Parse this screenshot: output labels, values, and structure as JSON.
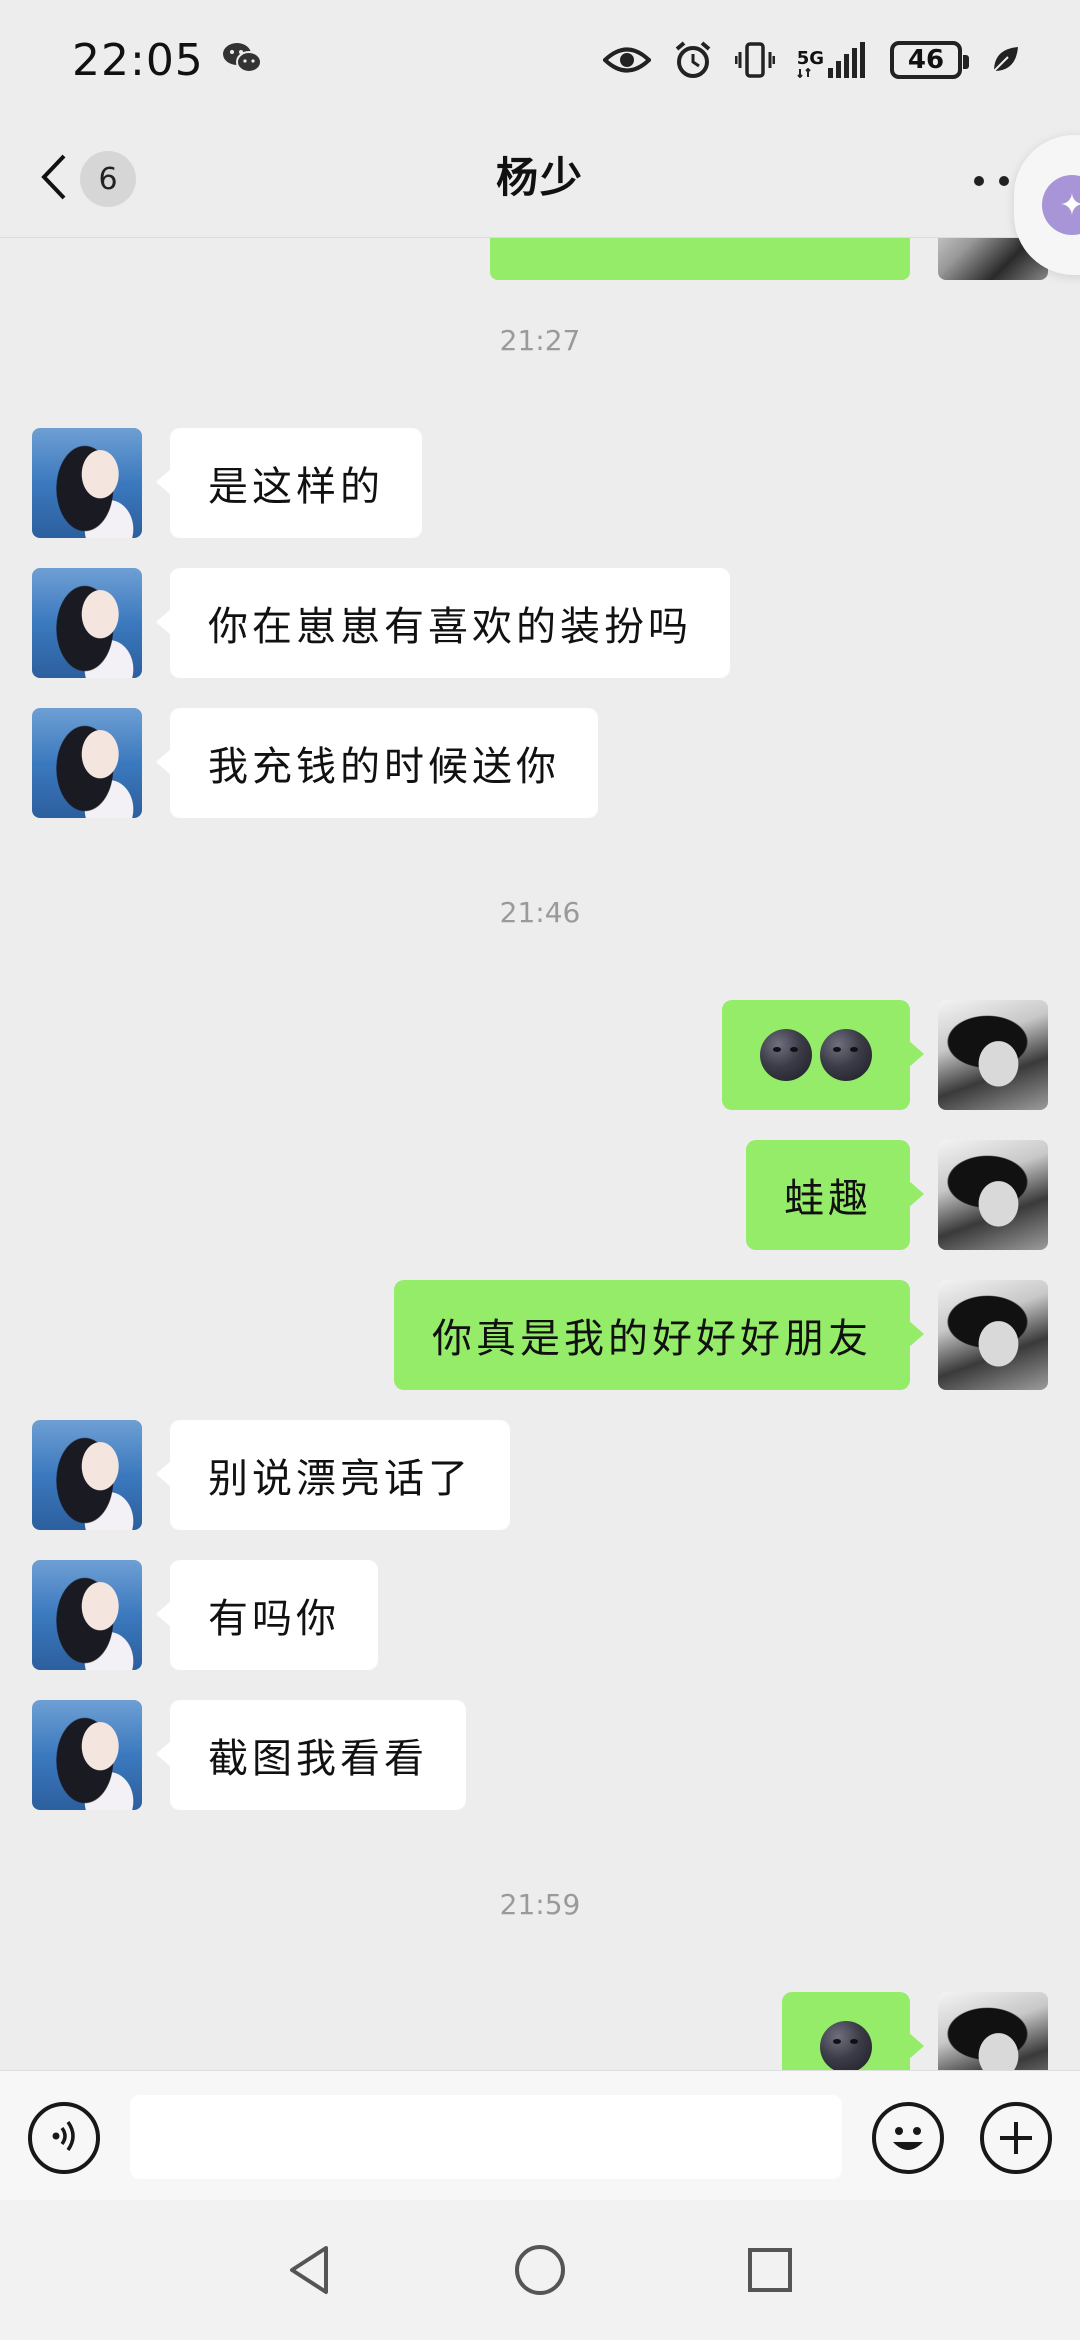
{
  "status_bar": {
    "time": "22:05",
    "network_label": "5G",
    "battery_level": "46",
    "icons": [
      "wechat-icon",
      "eye-icon",
      "alarm-icon",
      "vibrate-icon",
      "signal-icon",
      "battery-icon",
      "leaf-icon"
    ]
  },
  "header": {
    "unread_count": "6",
    "title": "杨少",
    "back_icon": "chevron-left-icon",
    "more_icon": "more-dots-icon"
  },
  "messages": [
    {
      "type": "time",
      "text": "21:27"
    },
    {
      "type": "text",
      "side": "left",
      "text": "是这样的"
    },
    {
      "type": "text",
      "side": "left",
      "text": "你在崽崽有喜欢的装扮吗"
    },
    {
      "type": "text",
      "side": "left",
      "text": "我充钱的时候送你"
    },
    {
      "type": "time",
      "text": "21:46"
    },
    {
      "type": "emoji",
      "side": "right",
      "emoji": "new-moon-face-icon x2"
    },
    {
      "type": "text",
      "side": "right",
      "text": "蛙趣"
    },
    {
      "type": "text",
      "side": "right",
      "text": "你真是我的好好好朋友"
    },
    {
      "type": "text",
      "side": "left",
      "text": "别说漂亮话了"
    },
    {
      "type": "text",
      "side": "left",
      "text": "有吗你"
    },
    {
      "type": "text",
      "side": "left",
      "text": "截图我看看"
    },
    {
      "type": "time",
      "text": "21:59"
    },
    {
      "type": "emoji",
      "side": "right",
      "emoji": "new-moon-face-icon x1"
    }
  ],
  "input_bar": {
    "value": "",
    "icons": [
      "voice-icon",
      "emoji-icon",
      "plus-icon"
    ]
  },
  "colors": {
    "background": "#ededed",
    "outgoing_bubble": "#95ec69",
    "incoming_bubble": "#ffffff"
  }
}
